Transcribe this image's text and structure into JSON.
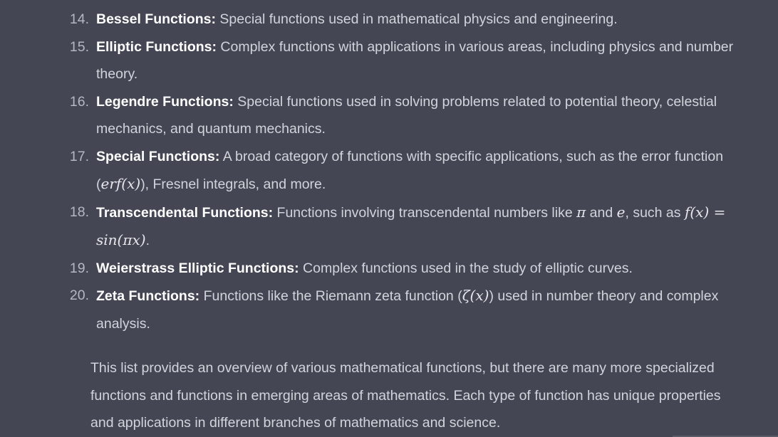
{
  "list": {
    "items": [
      {
        "number": "14.",
        "term": "Bessel Functions:",
        "desc_before": " Special functions used in mathematical physics and engineering.",
        "math": "",
        "desc_after": ""
      },
      {
        "number": "15.",
        "term": "Elliptic Functions:",
        "desc_before": " Complex functions with applications in various areas, including physics and number theory.",
        "math": "",
        "desc_after": ""
      },
      {
        "number": "16.",
        "term": "Legendre Functions:",
        "desc_before": " Special functions used in solving problems related to potential theory, celestial mechanics, and quantum mechanics.",
        "math": "",
        "desc_after": ""
      },
      {
        "number": "17.",
        "term": "Special Functions:",
        "desc_before": " A broad category of functions with specific applications, such as the error function (",
        "math": "erf(x)",
        "desc_after": "), Fresnel integrals, and more."
      },
      {
        "number": "18.",
        "term": "Transcendental Functions:",
        "desc_before": " Functions involving transcendental numbers like ",
        "math": "π",
        "desc_mid": " and ",
        "math2": "e",
        "desc_after": ", such as ",
        "math3": "f(x) = sin(πx)",
        "desc_end": "."
      },
      {
        "number": "19.",
        "term": "Weierstrass Elliptic Functions:",
        "desc_before": " Complex functions used in the study of elliptic curves.",
        "math": "",
        "desc_after": ""
      },
      {
        "number": "20.",
        "term": "Zeta Functions:",
        "desc_before": " Functions like the Riemann zeta function (",
        "math": "ζ(x)",
        "desc_after": ") used in number theory and complex analysis."
      }
    ]
  },
  "summary": {
    "text": "This list provides an overview of various mathematical functions, but there are many more specialized functions and functions in emerging areas of mathematics. Each type of function has unique properties and applications in different branches of mathematics and science."
  }
}
